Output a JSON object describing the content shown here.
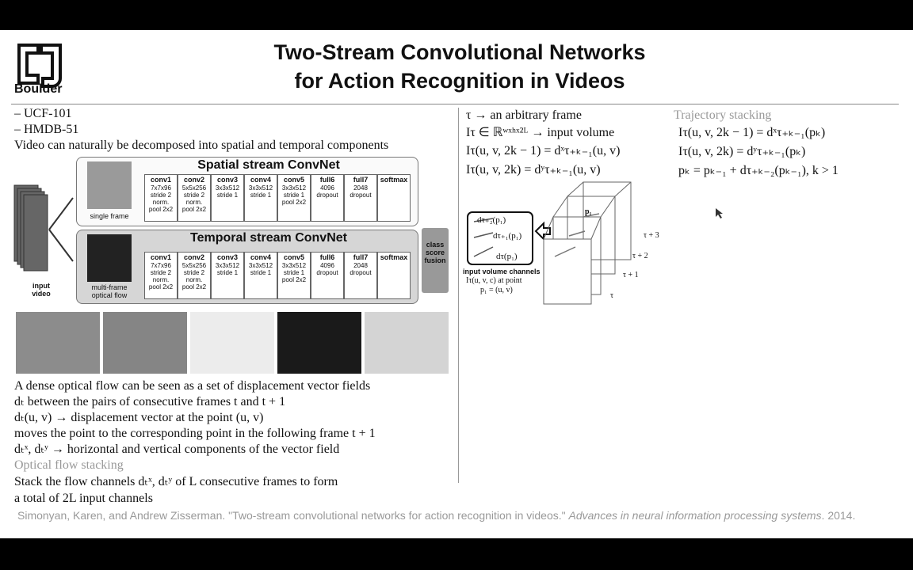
{
  "header": {
    "logo_text": "Boulder",
    "title_line1": "Two-Stream Convolutional Networks",
    "title_line2": "for Action Recognition in Videos"
  },
  "left": {
    "bullets": [
      "– UCF-101",
      "– HMDB-51"
    ],
    "intro": "Video can naturally be decomposed into spatial and temporal components",
    "flow_lines": [
      "A dense optical flow can be seen as a set of displacement vector fields",
      "dₜ between the pairs of consecutive frames t and t + 1",
      "dₜ(u, v) → displacement vector at the point (u, v)",
      "moves the point to the corresponding point in the following frame t + 1",
      "dₜˣ, dₜʸ → horizontal and vertical components of the vector field"
    ],
    "stacking_heading": "Optical flow stacking",
    "stacking_lines": [
      "Stack the flow channels dₜˣ, dₜʸ of L consecutive frames to form",
      "a total of 2L input channels"
    ]
  },
  "architecture": {
    "input_label_1": "input",
    "input_label_2": "video",
    "spatial_title": "Spatial stream ConvNet",
    "temporal_title": "Temporal stream ConvNet",
    "spatial_thumb_label": "single frame",
    "temporal_thumb_label_1": "multi-frame",
    "temporal_thumb_label_2": "optical flow",
    "fusion_label": [
      "class",
      "score",
      "fusion"
    ],
    "layers": [
      {
        "name": "conv1",
        "lines": [
          "7x7x96",
          "stride 2",
          "norm.",
          "pool 2x2"
        ]
      },
      {
        "name": "conv2",
        "lines": [
          "5x5x256",
          "stride 2",
          "norm.",
          "pool 2x2"
        ]
      },
      {
        "name": "conv3",
        "lines": [
          "3x3x512",
          "stride 1"
        ]
      },
      {
        "name": "conv4",
        "lines": [
          "3x3x512",
          "stride 1"
        ]
      },
      {
        "name": "conv5",
        "lines": [
          "3x3x512",
          "stride 1",
          "pool 2x2"
        ]
      },
      {
        "name": "full6",
        "lines": [
          "4096",
          "dropout"
        ]
      },
      {
        "name": "full7",
        "lines": [
          "2048",
          "dropout"
        ]
      },
      {
        "name": "softmax",
        "lines": []
      }
    ]
  },
  "right": {
    "eq_lines": [
      "τ → an arbitrary frame",
      "Iτ ∈ ℝʷˣʰˣ²ᴸ → input volume",
      "Iτ(u, v, 2k − 1) = dˣτ₊ₖ₋₁(u, v)",
      "Iτ(u, v, 2k) = dʸτ₊ₖ₋₁(u, v)"
    ],
    "traj_heading": "Trajectory stacking",
    "traj_lines": [
      "Iτ(u, v, 2k − 1) = dˣτ₊ₖ₋₁(pₖ)",
      "Iτ(u, v, 2k) = dʸτ₊ₖ₋₁(pₖ)",
      "pₖ = pₖ₋₁ + dτ₊ₖ₋₂(pₖ₋₁),  k > 1"
    ],
    "diagram": {
      "vectors": [
        "dτ₊₂(p₁)",
        "dτ₊₁(p₁)",
        "dτ(p₁)"
      ],
      "channels_label": "input volume channels",
      "at_point_label": "Iτ(u, v, c) at point",
      "point_eq": "p₁ = (u, v)",
      "cube_point": "p₁",
      "frame_labels": [
        "τ + 3",
        "τ + 2",
        "τ + 1",
        "τ"
      ]
    }
  },
  "citation": {
    "text": "Simonyan, Karen, and Andrew Zisserman. \"Two-stream convolutional networks for action recognition in videos.\" ",
    "venue": "Advances in neural information processing systems",
    "year": ". 2014."
  }
}
